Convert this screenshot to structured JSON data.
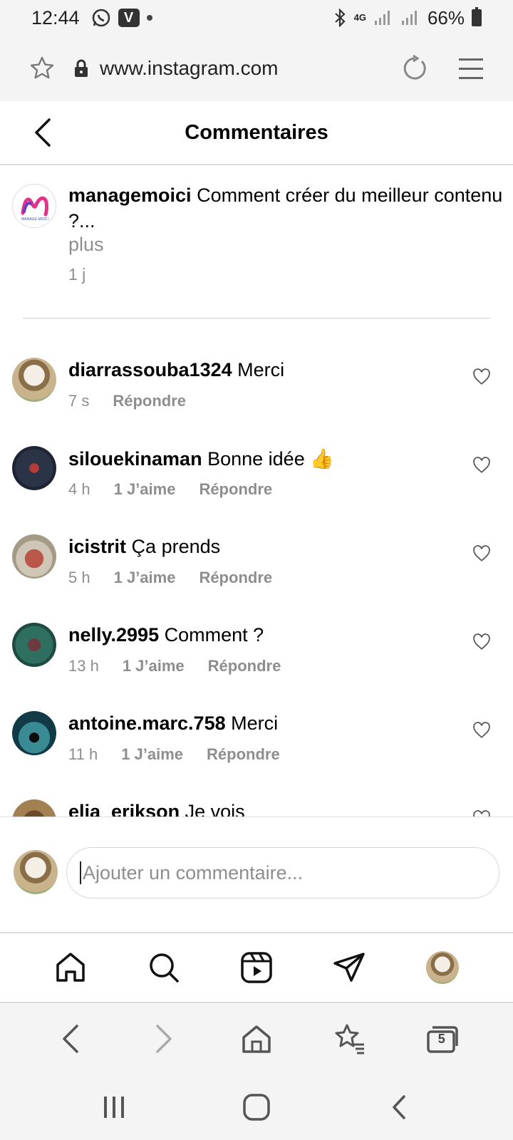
{
  "status_bar": {
    "time": "12:44",
    "battery": "66%",
    "network": "4G",
    "icons": [
      "whatsapp-icon",
      "v-app-icon",
      "dot-icon",
      "bluetooth-icon",
      "signal-icon",
      "battery-icon"
    ]
  },
  "browser": {
    "url": "www.instagram.com"
  },
  "header": {
    "title": "Commentaires"
  },
  "caption": {
    "username": "managemoici",
    "text": "Comment créer du meilleur contenu",
    "text_cont": "?...",
    "more": "plus",
    "time": "1 j",
    "avatar_text": "MANAGE-MOICI"
  },
  "comments": [
    {
      "username": "diarrassouba1324",
      "text": "Merci",
      "time": "7 s",
      "likes": "",
      "reply": "Répondre"
    },
    {
      "username": "silouekinaman",
      "text": "Bonne idée 👍",
      "time": "4 h",
      "likes": "1 J’aime",
      "reply": "Répondre"
    },
    {
      "username": "icistrit",
      "text": "Ça prends",
      "time": "5 h",
      "likes": "1 J’aime",
      "reply": "Répondre"
    },
    {
      "username": "nelly.2995",
      "text": "Comment ?",
      "time": "13 h",
      "likes": "1 J’aime",
      "reply": "Répondre"
    },
    {
      "username": "antoine.marc.758",
      "text": "Merci",
      "time": "11 h",
      "likes": "1 J’aime",
      "reply": "Répondre"
    },
    {
      "username": "elia_erikson",
      "text": "Je vois",
      "time": "",
      "likes": "",
      "reply": ""
    }
  ],
  "add_comment": {
    "placeholder": "Ajouter un commentaire..."
  },
  "browser_toolbar": {
    "tab_count": "5"
  },
  "colors": {
    "secondary_text": "#8e8e8e",
    "chrome_bg": "#f4f4f4",
    "divider": "#dcdcdc"
  }
}
